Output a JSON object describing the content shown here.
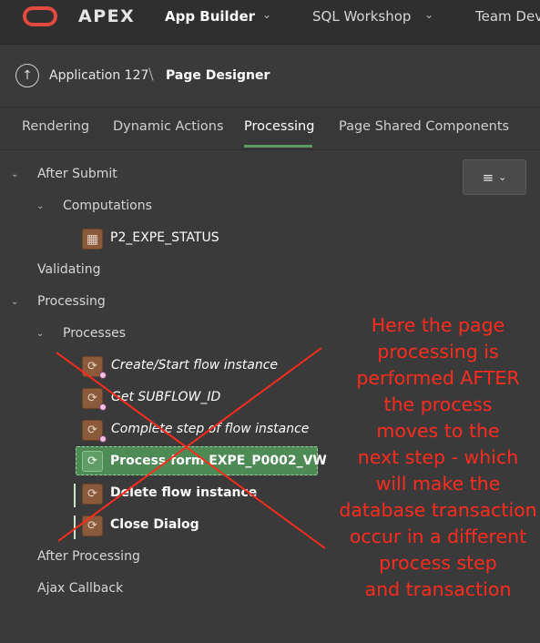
{
  "topnav": {
    "brand": "APEX",
    "items": [
      {
        "label": "App Builder",
        "active": true
      },
      {
        "label": "SQL Workshop",
        "active": false
      },
      {
        "label": "Team Dev",
        "active": false
      }
    ]
  },
  "breadcrumb": {
    "items": [
      "Application 127",
      "Page Designer"
    ],
    "separator": "\\"
  },
  "tabs": [
    "Rendering",
    "Dynamic Actions",
    "Processing",
    "Page Shared Components"
  ],
  "active_tab": "Processing",
  "tree": {
    "after_submit": "After Submit",
    "computations": "Computations",
    "computation_item": "P2_EXPE_STATUS",
    "validating": "Validating",
    "processing": "Processing",
    "processes": "Processes",
    "process_items": [
      {
        "label": "Create/Start flow instance",
        "italic": true,
        "condition": true
      },
      {
        "label": "Get SUBFLOW_ID",
        "italic": true,
        "condition": true
      },
      {
        "label": "Complete step of flow instance",
        "italic": true,
        "condition": true
      },
      {
        "label": "Process form EXPE_P0002_VW",
        "italic": false,
        "selected": true
      },
      {
        "label": "Delete flow instance",
        "italic": false
      },
      {
        "label": "Close Dialog",
        "italic": false
      }
    ],
    "after_processing": "After Processing",
    "ajax_callback": "Ajax Callback"
  },
  "annotation": {
    "lines": [
      "Here the page",
      "processing is",
      "performed AFTER",
      "the process",
      "moves to the",
      "next step - which",
      "will make the",
      "database transaction",
      "occur in a different",
      "process step",
      "and transaction"
    ],
    "color": "#ff2b1f"
  },
  "colors": {
    "accent_green": "#5e9a63",
    "process_icon": "#8a5a3a",
    "brand_red": "#e24a40"
  }
}
